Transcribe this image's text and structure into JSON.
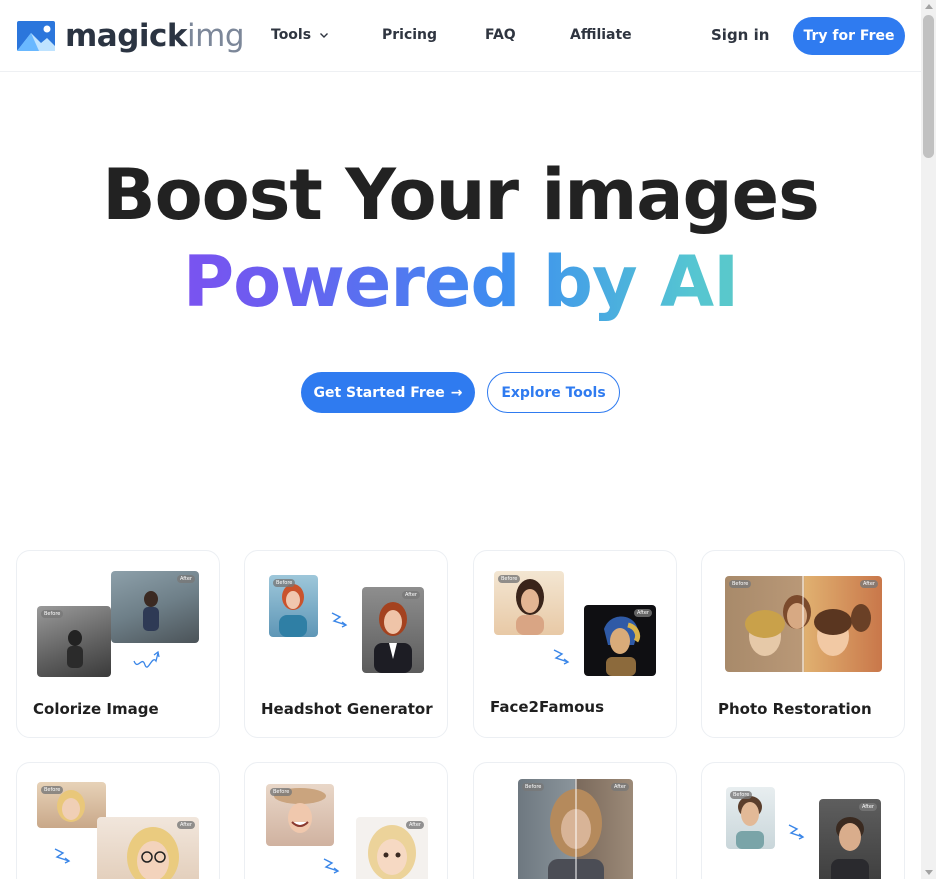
{
  "header": {
    "logo_part1": "magick",
    "logo_part2": "img",
    "nav": {
      "tools": "Tools",
      "pricing": "Pricing",
      "faq": "FAQ",
      "affiliate": "Affiliate"
    },
    "sign_in": "Sign in",
    "try_button": "Try for Free"
  },
  "hero": {
    "line1": "Boost Your images",
    "line2": "Powered by AI",
    "primary_button": "Get Started Free",
    "secondary_button": "Explore Tools"
  },
  "image_tags": {
    "before": "Before",
    "after": "After"
  },
  "tools": [
    {
      "title": "Colorize Image"
    },
    {
      "title": "Headshot Generator"
    },
    {
      "title": "Face2Famous"
    },
    {
      "title": "Photo Restoration"
    },
    {
      "title": ""
    },
    {
      "title": ""
    },
    {
      "title": ""
    },
    {
      "title": ""
    }
  ],
  "colors": {
    "accent": "#2f7bf0",
    "gradient": [
      "#9b3cf0",
      "#3d8ff0",
      "#6fd8a9"
    ]
  }
}
